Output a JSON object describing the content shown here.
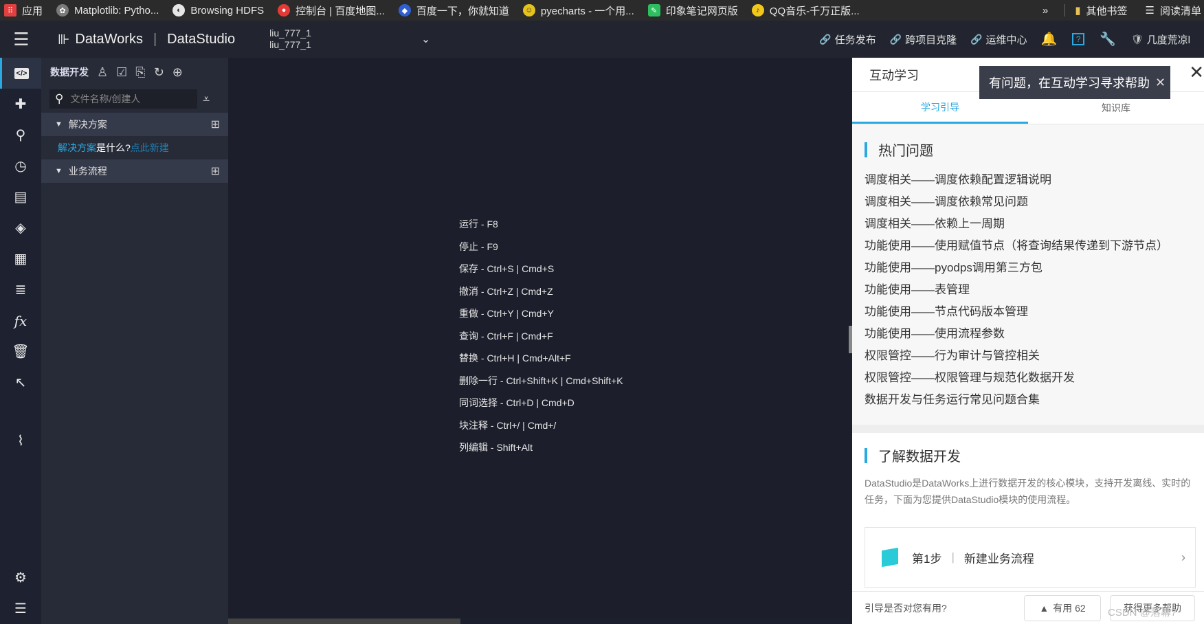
{
  "bookmarks": {
    "items": [
      "应用",
      "Matplotlib: Pytho...",
      "Browsing HDFS",
      "控制台 | 百度地图...",
      "百度一下，你就知道",
      "pyecharts - 一个用...",
      "印象笔记网页版",
      "QQ音乐-千万正版..."
    ],
    "more": "»",
    "other": "其他书签",
    "reading": "阅读清单"
  },
  "header": {
    "brand": "DataWorks",
    "module": "DataStudio",
    "project_line1": "liu_777_1",
    "project_line2": "liu_777_1",
    "links": [
      "任务发布",
      "跨项目克隆",
      "运维中心"
    ],
    "user": "几度荒凉l"
  },
  "sidebar": {
    "title": "数据开发",
    "search_placeholder": "文件名称/创建人",
    "group1": "解决方案",
    "solution_q_a": "解决方案",
    "solution_q_b": "是什么?",
    "solution_q_c": "点此新建",
    "group2": "业务流程"
  },
  "shortcuts": [
    "运行 - F8",
    "停止 - F9",
    "保存 - Ctrl+S | Cmd+S",
    "撤消 - Ctrl+Z | Cmd+Z",
    "重做 - Ctrl+Y | Cmd+Y",
    "查询 - Ctrl+F | Cmd+F",
    "替换 - Ctrl+H | Cmd+Alt+F",
    "删除一行 - Ctrl+Shift+K | Cmd+Shift+K",
    "同词选择 - Ctrl+D | Cmd+D",
    "块注释 - Ctrl+/ | Cmd+/",
    "列编辑 - Shift+Alt"
  ],
  "help": {
    "title": "互动学习",
    "tip": "有问题，在互动学习寻求帮助",
    "tab1": "学习引导",
    "tab2": "知识库",
    "hot_title": "热门问题",
    "faqs": [
      "调度相关——调度依赖配置逻辑说明",
      "调度相关——调度依赖常见问题",
      "调度相关——依赖上一周期",
      "功能使用——使用赋值节点（将查询结果传递到下游节点）",
      "功能使用——pyodps调用第三方包",
      "功能使用——表管理",
      "功能使用——节点代码版本管理",
      "功能使用——使用流程参数",
      "权限管控——行为审计与管控相关",
      "权限管控——权限管理与规范化数据开发",
      "数据开发与任务运行常见问题合集"
    ],
    "learn_title": "了解数据开发",
    "learn_desc": "DataStudio是DataWorks上进行数据开发的核心模块，支持开发离线、实时的任务，下面为您提供DataStudio模块的使用流程。",
    "step_label": "第1步",
    "step_text": "新建业务流程",
    "foot_q": "引导是否对您有用?",
    "useful": "有用 62",
    "more": "获得更多帮助"
  },
  "watermark": "CSDN @落幕7"
}
